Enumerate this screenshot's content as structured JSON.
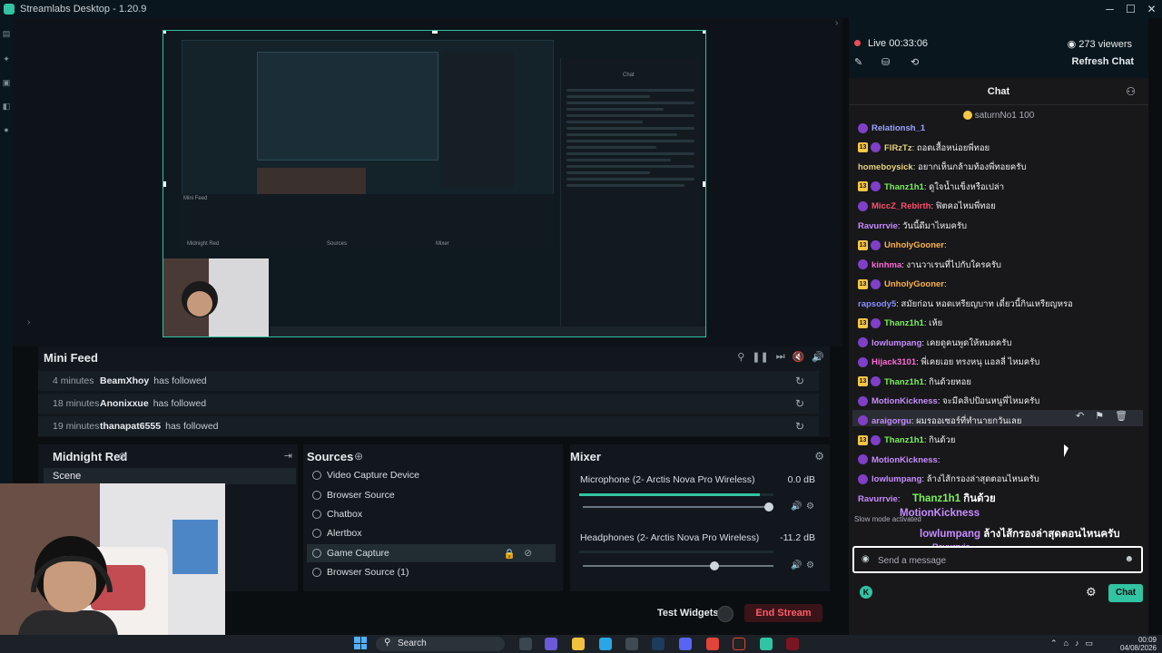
{
  "titlebar": {
    "title": "Streamlabs Desktop - 1.20.9",
    "minimize": "─",
    "maximize": "☐",
    "close": "✕"
  },
  "preview": {
    "minifeed_label": "Mini Feed",
    "scene_label": "Midnight Red",
    "sources_label": "Sources",
    "mixer_label": "Mixer",
    "chat_label": "Chat"
  },
  "minifeed": {
    "title": "Mini Feed",
    "rows": [
      {
        "time": "4 minutes",
        "name": "BeamXhoy",
        "action": "has followed"
      },
      {
        "time": "18 minutes",
        "name": "Anonixxue",
        "action": "has followed"
      },
      {
        "time": "19 minutes",
        "name": "thanapat6555",
        "action": "has followed"
      }
    ]
  },
  "scenes": {
    "title": "Midnight Red",
    "items": [
      "Scene"
    ]
  },
  "sources": {
    "title": "Sources",
    "items": [
      "Video Capture Device",
      "Browser Source",
      "Chatbox",
      "Alertbox",
      "Game Capture",
      "Browser Source (1)"
    ],
    "selected_index": 4
  },
  "mixer": {
    "title": "Mixer",
    "channels": [
      {
        "name": "Microphone (2- Arctis Nova Pro Wireless)",
        "db": "0.0 dB",
        "meter": 0.93,
        "volume": 1.0
      },
      {
        "name": "Headphones (2- Arctis Nova Pro Wireless)",
        "db": "-11.2 dB",
        "meter": 0.0,
        "volume": 0.7
      }
    ]
  },
  "footer": {
    "test_widgets": "Test Widgets",
    "end_stream": "End Stream"
  },
  "chat": {
    "live": "Live 00:33:06",
    "viewers": "273 viewers",
    "refresh": "Refresh Chat",
    "header": "Chat",
    "pinned_user": "saturnNo1",
    "pinned_amount": "100",
    "messages": [
      {
        "user": "Relationsh_1",
        "text": "",
        "color": "#9aa4ff",
        "badge": "sub"
      },
      {
        "user": "FlRzTz",
        "text": ": ถอดเสื้อหน่อยพี่ทอย",
        "color": "#e6d27a",
        "badge": "13"
      },
      {
        "user": "homeboysick",
        "text": ": อยากเห็นกล้ามท้องพี่ทอยครับ",
        "color": "#e6d27a",
        "badge": ""
      },
      {
        "user": "Thanz1h1",
        "text": ": ดูใจน้ำแข็งหรือเปล่า",
        "color": "#7cf05b",
        "badge": "13"
      },
      {
        "user": "MiccZ_Rebirth",
        "text": ": ฟิตคอไหมพี่ทอย",
        "color": "#ff4f6b",
        "badge": "sub"
      },
      {
        "user": "Ravurrvie",
        "text": ": วันนี้ดีมาไหมครับ",
        "color": "#c88cff",
        "badge": ""
      },
      {
        "user": "UnholyGooner",
        "text": ":",
        "color": "#ffb347",
        "badge": "13"
      },
      {
        "user": "kinhma",
        "text": ": งานวาเรนที่ไปกับใครครับ",
        "color": "#ff6bd6",
        "badge": "sub"
      },
      {
        "user": "UnholyGooner",
        "text": ":",
        "color": "#ffb347",
        "badge": "13"
      },
      {
        "user": "rapsody5",
        "text": ": สมัยก่อน หอดเหรียญบาท เดี๋ยวนี้กินเหรียญหรอ",
        "color": "#8a8cff",
        "badge": ""
      },
      {
        "user": "Thanz1h1",
        "text": ": เห้ย",
        "color": "#7cf05b",
        "badge": "13"
      },
      {
        "user": "lowlumpang",
        "text": ": เคยดูคนพูดให้หมดครับ",
        "color": "#c88cff",
        "badge": "sub"
      },
      {
        "user": "Hijack3101",
        "text": ": พี่เคยเอย ทรงหนุ แอลลี่ ไหมครับ",
        "color": "#ff6bd6",
        "badge": "sub"
      },
      {
        "user": "Thanz1h1",
        "text": ": กินด้วยทอย",
        "color": "#7cf05b",
        "badge": "13"
      },
      {
        "user": "MotionKickness",
        "text": ": จะมีคลิปป้อนหนูพี่ไหมครับ",
        "color": "#c88cff",
        "badge": "sub"
      },
      {
        "user": "araigorgu",
        "text": ": ผมรออเซอร์ที่ทำนายกวันเลย",
        "color": "#c88cff",
        "badge": "sub"
      },
      {
        "user": "Thanz1h1",
        "text": ": กินด้วย",
        "color": "#7cf05b",
        "badge": "13"
      },
      {
        "user": "MotionKickness",
        "text": ":",
        "color": "#c88cff",
        "badge": "sub"
      },
      {
        "user": "lowlumpang",
        "text": ": ล้างไส้กรองล่าสุดตอนไหนครับ",
        "color": "#c88cff",
        "badge": "sub"
      },
      {
        "user": "Ravurrvie",
        "text": ":",
        "color": "#c88cff",
        "badge": ""
      }
    ],
    "overlay": [
      {
        "user": "Thanz1h1",
        "text": "กินด้วย",
        "color": "#7cf05b"
      },
      {
        "user": "MotionKickness",
        "text": "",
        "color": "#c88cff"
      },
      {
        "user": "lowlumpang",
        "text": "ล้างไส้กรองล่าสุดตอนไหนครับ",
        "color": "#c88cff"
      },
      {
        "user": "Ravurrvie",
        "text": "",
        "color": "#c88cff"
      }
    ],
    "slow_mode": "Slow mode activated",
    "input_placeholder": "Send a message",
    "send_label": "Chat"
  },
  "taskbar": {
    "search": "Search",
    "time": "00:09",
    "date": "04/08/2026"
  },
  "icons": {
    "pencil": "✎",
    "gift": "⛁",
    "share": "⟲",
    "eye": "◉",
    "gear": "⚙",
    "repeat": "↻",
    "plus": "⊕",
    "pause": "❚❚",
    "skip": "⏭",
    "filter": "⚲",
    "mute": "🔇",
    "volume": "🔊",
    "lock": "🔒",
    "eye_off": "⊘"
  }
}
